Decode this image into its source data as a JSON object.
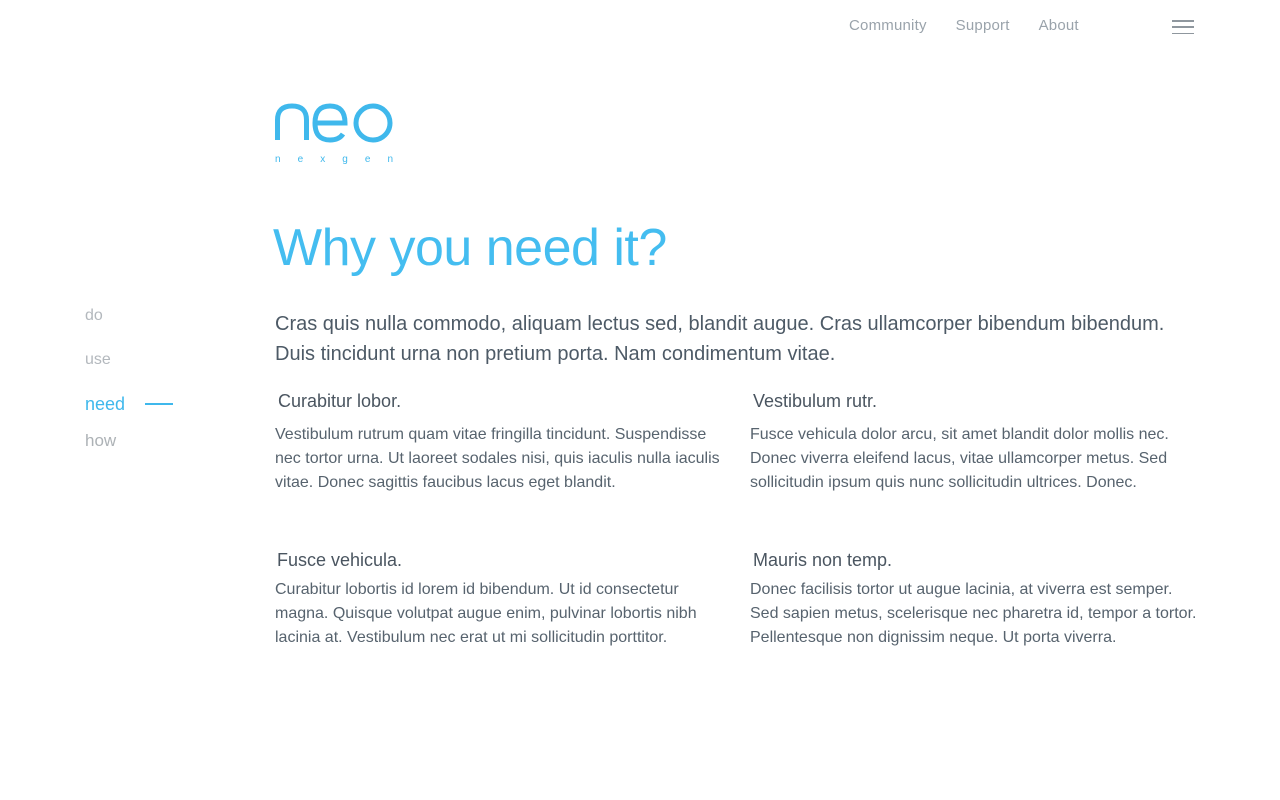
{
  "nav": {
    "links": [
      "Community",
      "Support",
      "About"
    ],
    "menu_icon": "hamburger-menu-icon"
  },
  "logo": {
    "wordmark": "neo",
    "tagline": "n e x g e n",
    "color": "#3fb8ec"
  },
  "sidenav": {
    "items": [
      "do",
      "use",
      "need",
      "how"
    ],
    "active": "need",
    "accent_color": "#3fb8ec"
  },
  "main": {
    "headline": "Why you need it?",
    "intro": "Cras quis nulla commodo, aliquam lectus sed, blandit augue. Cras ullamcorper bibendum bibendum. Duis tincidunt urna non pretium porta. Nam condimentum vitae.",
    "features": [
      {
        "title": "Curabitur lobor.",
        "body": "Vestibulum rutrum quam vitae fringilla tincidunt. Suspendisse nec tortor urna. Ut laoreet sodales nisi, quis iaculis nulla iaculis vitae. Donec sagittis faucibus lacus eget blandit."
      },
      {
        "title": "Vestibulum rutr.",
        "body": "Fusce vehicula dolor arcu, sit amet blandit dolor mollis nec. Donec viverra eleifend lacus, vitae ullamcorper metus. Sed sollicitudin ipsum quis nunc sollicitudin ultrices. Donec."
      },
      {
        "title": "Fusce vehicula.",
        "body": "Curabitur lobortis id lorem id bibendum. Ut id consectetur magna. Quisque volutpat augue enim, pulvinar lobortis nibh lacinia at. Vestibulum nec erat ut mi sollicitudin porttitor."
      },
      {
        "title": "Mauris non temp.",
        "body": "Donec facilisis tortor ut augue lacinia, at viverra est semper. Sed sapien metus, scelerisque nec pharetra id, tempor a tortor. Pellentesque non dignissim neque. Ut porta viverra."
      }
    ]
  }
}
